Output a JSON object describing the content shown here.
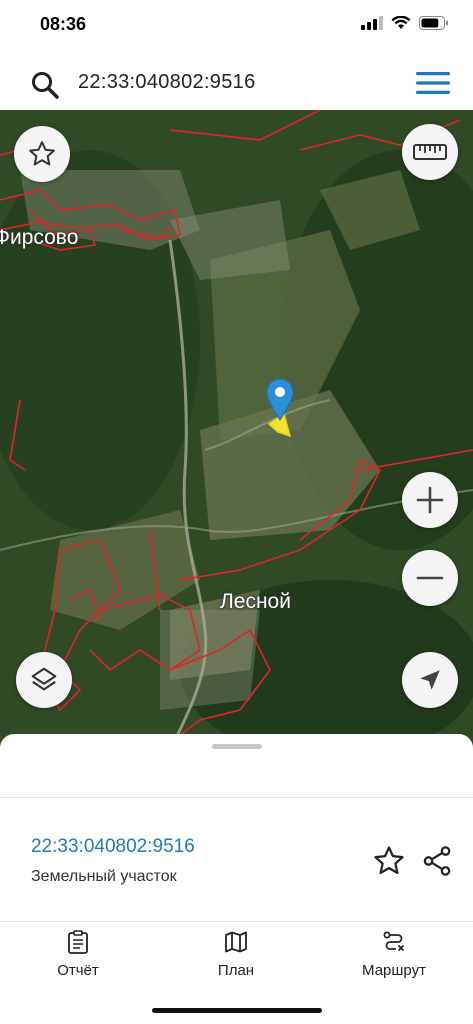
{
  "status_bar": {
    "time": "08:36",
    "battery_level": 0.8
  },
  "search": {
    "value": "22:33:040802:9516"
  },
  "map": {
    "labels": {
      "firsovo": "Фирсово",
      "lesnoy": "Лесной"
    },
    "buttons": [
      "star-icon",
      "ruler-icon",
      "plus-icon",
      "minus-icon",
      "locate-arrow-icon",
      "layers-icon"
    ],
    "colors": {
      "boundary": "#e0242c",
      "marker": "#2a8fd6",
      "parcel": "#f2e32a"
    }
  },
  "parcel": {
    "number": "22:33:040802:9516",
    "type": "Земельный участок"
  },
  "tabs": [
    {
      "label": "Отчёт",
      "icon": "report-icon"
    },
    {
      "label": "План",
      "icon": "map-plan-icon"
    },
    {
      "label": "Маршрут",
      "icon": "route-icon"
    }
  ],
  "colors": {
    "accent": "#1f7ab5",
    "menu": "#1f7ab5"
  }
}
